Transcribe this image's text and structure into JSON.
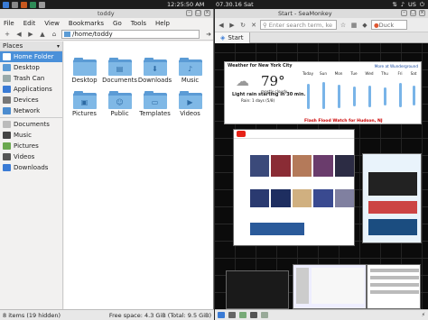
{
  "panel": {
    "clock": "12:25:50 AM",
    "date": "07.30.16 Sat",
    "keyboard_layout": "US"
  },
  "file_manager": {
    "title": "toddy",
    "menu": [
      "File",
      "Edit",
      "View",
      "Bookmarks",
      "Go",
      "Tools",
      "Help"
    ],
    "path": "/home/toddy",
    "sidebar_header": "Places",
    "places": [
      {
        "label": "Home Folder",
        "icon": "home-icon",
        "selected": true
      },
      {
        "label": "Desktop",
        "icon": "desktop-icon",
        "selected": false
      },
      {
        "label": "Trash Can",
        "icon": "trash-icon",
        "selected": false
      },
      {
        "label": "Applications",
        "icon": "applications-icon",
        "selected": false
      },
      {
        "label": "Devices",
        "icon": "devices-icon",
        "selected": false
      },
      {
        "label": "Network",
        "icon": "network-icon",
        "selected": false
      },
      {
        "label": "Documents",
        "icon": "documents-icon",
        "selected": false
      },
      {
        "label": "Music",
        "icon": "music-icon",
        "selected": false
      },
      {
        "label": "Pictures",
        "icon": "pictures-icon",
        "selected": false
      },
      {
        "label": "Videos",
        "icon": "videos-icon",
        "selected": false
      },
      {
        "label": "Downloads",
        "icon": "downloads-icon",
        "selected": false
      }
    ],
    "folders": [
      "Desktop",
      "Documents",
      "Downloads",
      "Music",
      "Pictures",
      "Public",
      "Templates",
      "Videos"
    ],
    "status_left": "8 items (19 hidden)",
    "status_right": "Free space: 4.3 GiB (Total: 9.5 GiB)"
  },
  "browser": {
    "title": "Start - SeaMonkey",
    "url_placeholder": "Enter search term, ke",
    "search_engine": "Duck",
    "tab_label": "Start",
    "weather": {
      "title": "Weather for New York City",
      "more_link": "More at Wunderground",
      "temperature": "79°",
      "condition": "mostly cloudy",
      "rain_text": "Light rain starting in 30 min.",
      "rain_sub": "Rain: 1 days (5/8)",
      "alert": "Flash Flood Watch for Hudson, NJ",
      "days": [
        "Today",
        "Sun",
        "Mon",
        "Tue",
        "Wed",
        "Thu",
        "Fri",
        "Sat"
      ]
    },
    "accent": "#4a90d9",
    "folder_color": "#5b9bd5"
  }
}
